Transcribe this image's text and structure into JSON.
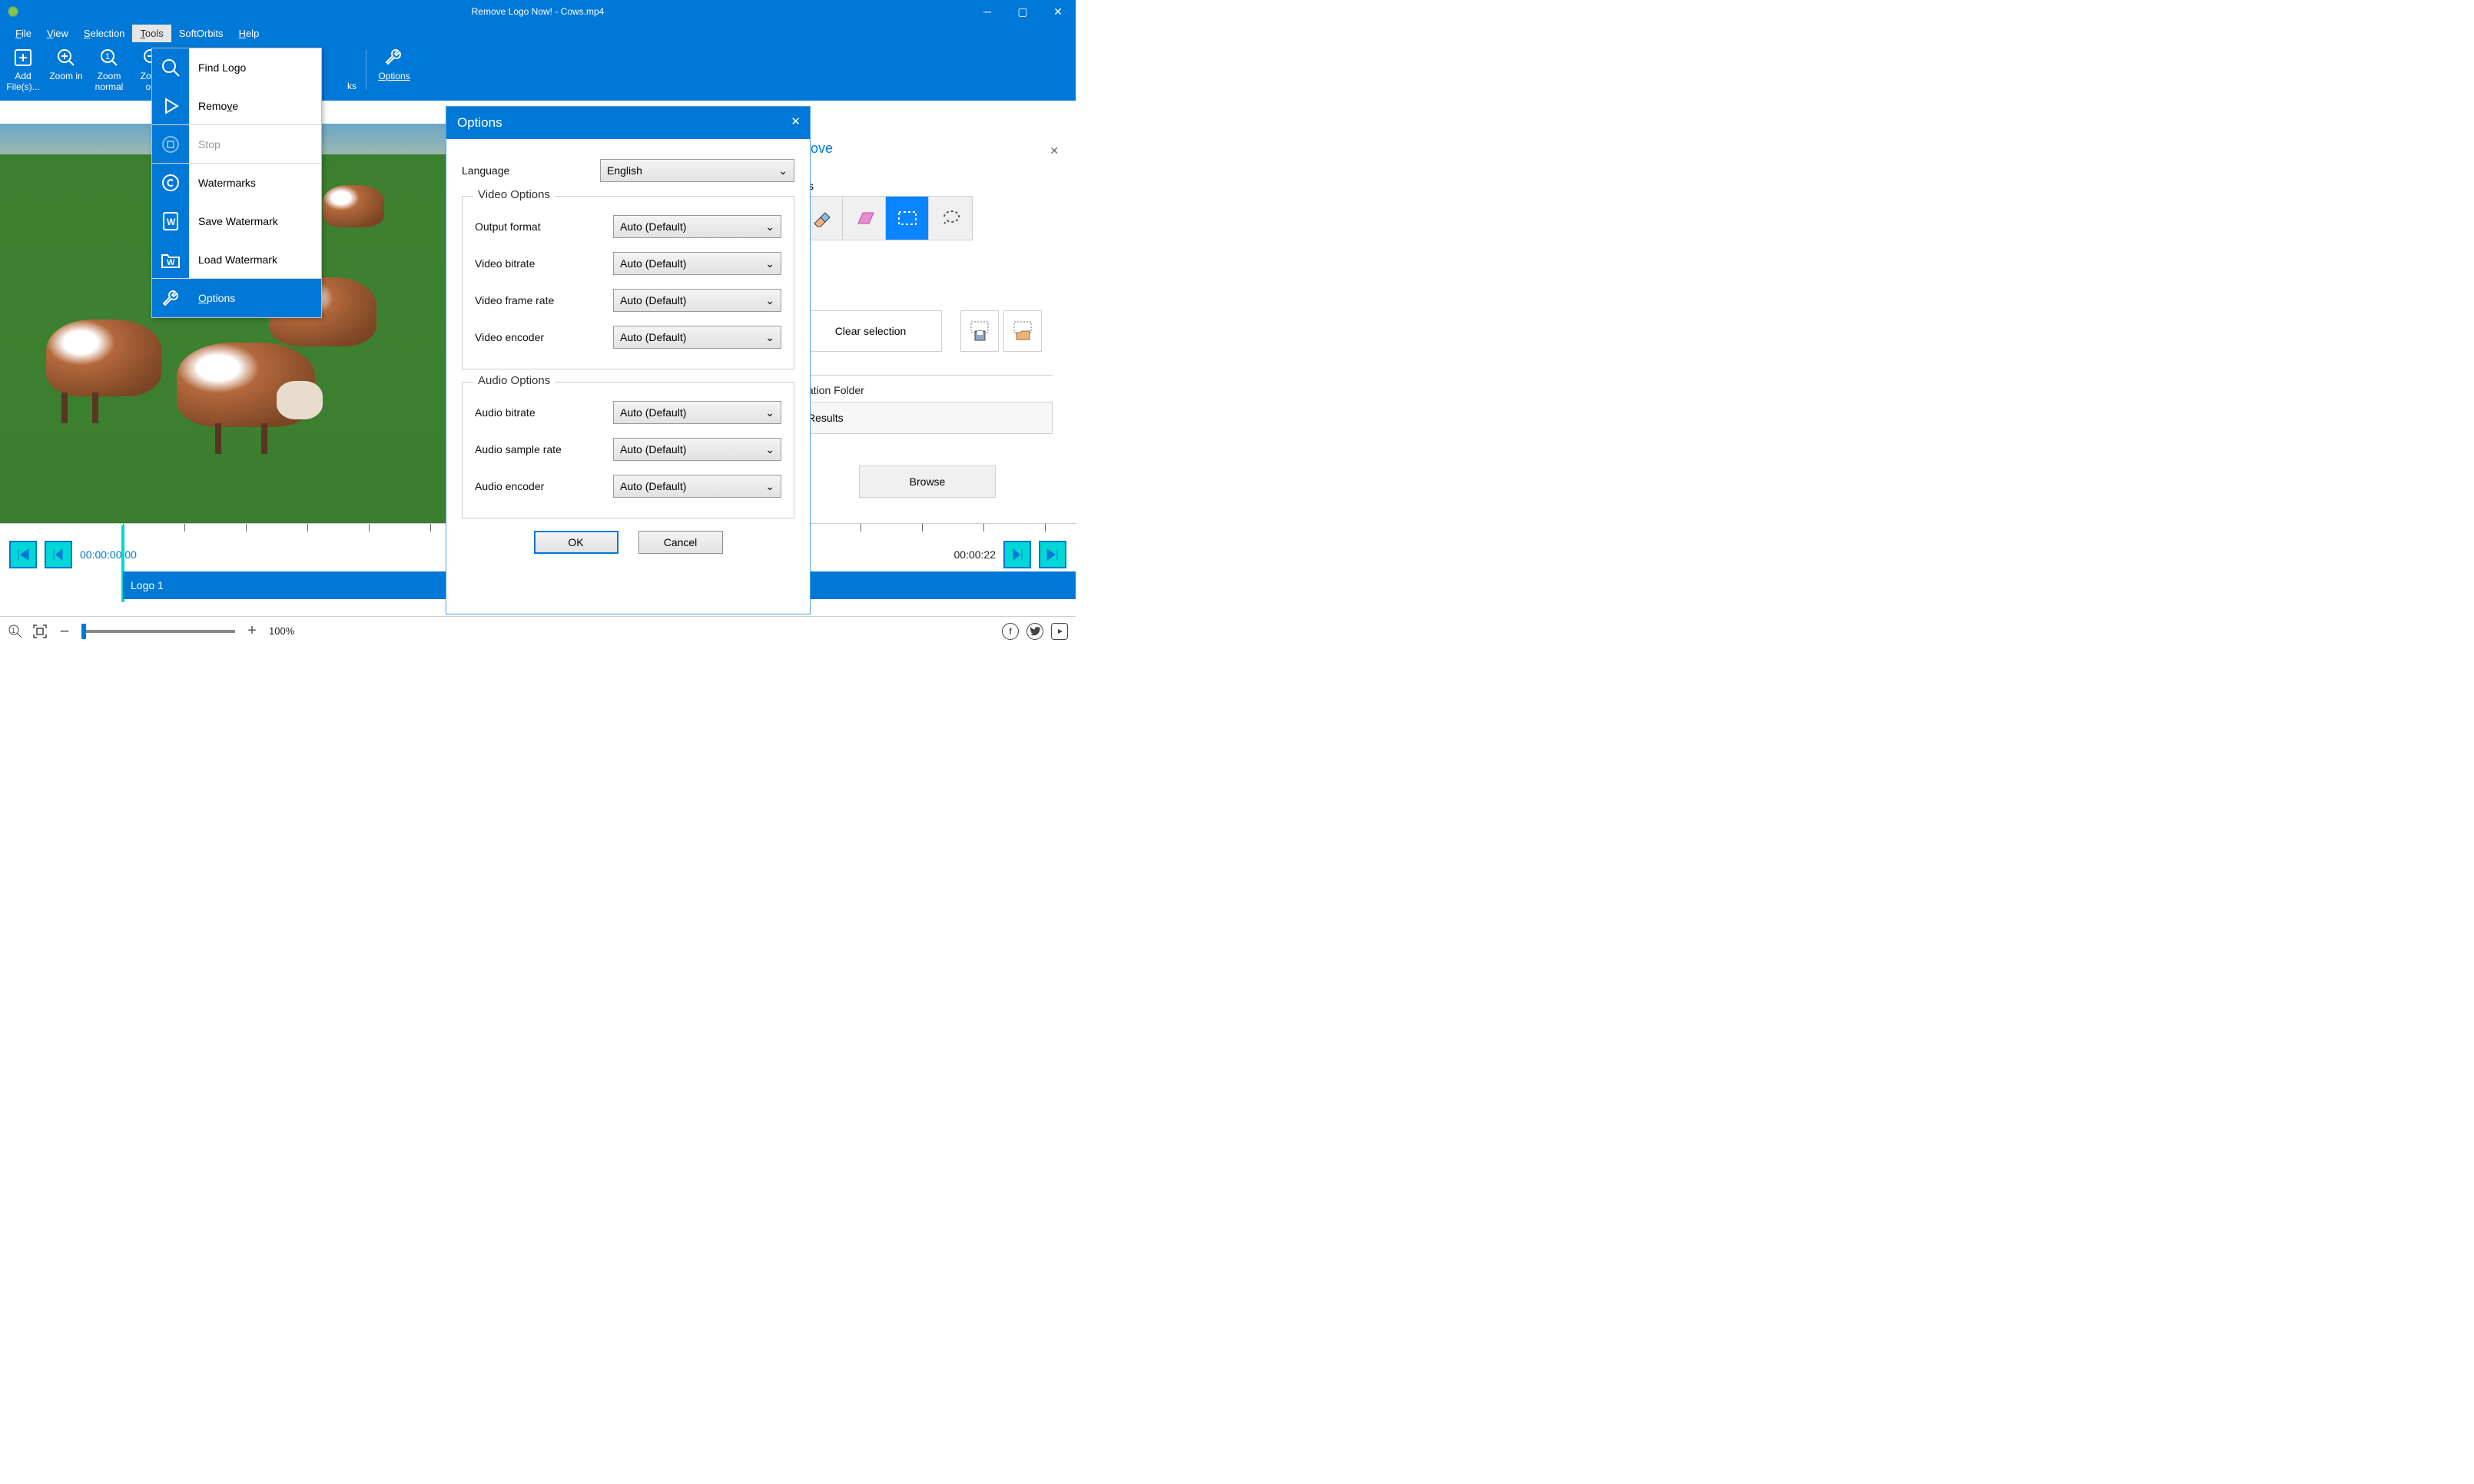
{
  "window": {
    "title": "Remove Logo Now! - Cows.mp4"
  },
  "menubar": [
    "File",
    "View",
    "Selection",
    "Tools",
    "SoftOrbits",
    "Help"
  ],
  "menubar_underline_idx": [
    0,
    0,
    0,
    0,
    -1,
    0
  ],
  "menubar_active": "Tools",
  "toolbar": [
    {
      "label": "Add File(s)...",
      "icon": "add-file-icon"
    },
    {
      "label": "Zoom in",
      "icon": "zoom-in-icon"
    },
    {
      "label": "Zoom normal",
      "icon": "zoom-1-icon"
    },
    {
      "label": "Zoom out",
      "icon": "zoom-out-icon"
    },
    {
      "label": "Options",
      "icon": "wrench-icon",
      "underline": true
    }
  ],
  "dropdown": {
    "items": [
      {
        "label": "Find Logo",
        "icon_svg": "search"
      },
      {
        "label": "Remove",
        "ul_char": "v",
        "icon_svg": "play",
        "sep": true
      },
      {
        "label": "Stop",
        "disabled": true,
        "icon_svg": "stop",
        "sep": true
      },
      {
        "label": "Watermarks",
        "icon_svg": "copyright"
      },
      {
        "label": "Save Watermark",
        "icon_svg": "doc-w"
      },
      {
        "label": "Load Watermark",
        "icon_svg": "folder-w",
        "sep": true
      },
      {
        "label": "Options",
        "ul_char": "O",
        "hover": true,
        "icon_svg": "wrench"
      }
    ]
  },
  "options_dialog": {
    "title": "Options",
    "language_label": "Language",
    "language_value": "English",
    "video_group_title": "Video Options",
    "video_rows": [
      {
        "label": "Output format",
        "value": "Auto (Default)"
      },
      {
        "label": "Video bitrate",
        "value": "Auto (Default)"
      },
      {
        "label": "Video frame rate",
        "value": "Auto (Default)"
      },
      {
        "label": "Video encoder",
        "value": "Auto (Default)"
      }
    ],
    "audio_group_title": "Audio Options",
    "audio_rows": [
      {
        "label": "Audio bitrate",
        "value": "Auto (Default)"
      },
      {
        "label": "Audio sample rate",
        "value": "Auto (Default)"
      },
      {
        "label": "Audio encoder",
        "value": "Auto (Default)"
      }
    ],
    "ok": "OK",
    "cancel": "Cancel"
  },
  "right_panel": {
    "title_fragment": "move",
    "tools_label_fragment": "s",
    "clear_selection": "Clear selection",
    "destination_label": "ination Folder",
    "destination_value": "Results",
    "browse": "Browse"
  },
  "timeline": {
    "start_time": "00:00:00 00",
    "end_time": "00:00:22",
    "logo_label": "Logo 1"
  },
  "statusbar": {
    "zoom_pct": "100%"
  }
}
